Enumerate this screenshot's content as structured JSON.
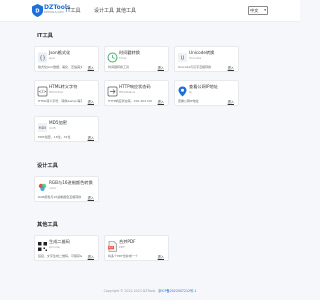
{
  "header": {
    "logo_text": "DZTools",
    "logo_sub": "DZTOOLS.COM",
    "nav": [
      "IT工具",
      "设计工具",
      "其他工具"
    ],
    "language": "中文"
  },
  "sections": [
    {
      "title": "IT工具",
      "cards": [
        {
          "title": "Json格式化",
          "subtitle": "Json",
          "desc": "格式化Json数据，美化、压缩其文本",
          "link": "进入",
          "icon": "json-icon"
        },
        {
          "title": "时间戳转换",
          "subtitle": "Time",
          "desc": "时间戳转换工具",
          "link": "进入",
          "icon": "clock-icon"
        },
        {
          "title": "Unicode转换",
          "subtitle": "Unicode",
          "desc": "Unicode与汉字互相转换",
          "link": "进入",
          "icon": "unicode-icon"
        },
        {
          "title": "HTML转义字符",
          "subtitle": "HtmlChar",
          "desc": "HTML转义字符、转换&amp;等字符",
          "link": "进入",
          "icon": "html-icon"
        },
        {
          "title": "HTTP响应状态码",
          "subtitle": "HttpStatus",
          "desc": "HTTP响应状态码、200 404 500",
          "link": "进入",
          "icon": "http-icon"
        },
        {
          "title": "查看公网IP地址",
          "subtitle": "Ip",
          "desc": "查看公网IP地址",
          "link": "进入",
          "icon": "location-icon"
        },
        {
          "title": "MD5加密",
          "subtitle": "md5",
          "desc": "MD5加密，16位，32位",
          "link": "进入",
          "icon": "md5-icon"
        }
      ]
    },
    {
      "title": "设计工具",
      "cards": [
        {
          "title": "RGB与16进制颜色转换",
          "subtitle": "color",
          "desc": "RGB颜色与16进制颜色互相转换",
          "link": "进入",
          "icon": "color-icon"
        }
      ]
    },
    {
      "title": "其他工具",
      "cards": [
        {
          "title": "生成二维码",
          "subtitle": "Qrcode",
          "desc": "链接、文字生成二维码，可保存&下载",
          "link": "进入",
          "icon": "qrcode-icon"
        },
        {
          "title": "合并PDF",
          "subtitle": "PDF",
          "desc": "将多个PDF合并成一个",
          "link": "进入",
          "icon": "pdf-icon"
        }
      ]
    }
  ],
  "footer": {
    "copyright": "Copyright © 2022-2023 DZTools",
    "icp": "京ICP备2022007212号-1"
  },
  "colors": {
    "accent": "#1e6fd9",
    "background": "#f6f7fb"
  }
}
